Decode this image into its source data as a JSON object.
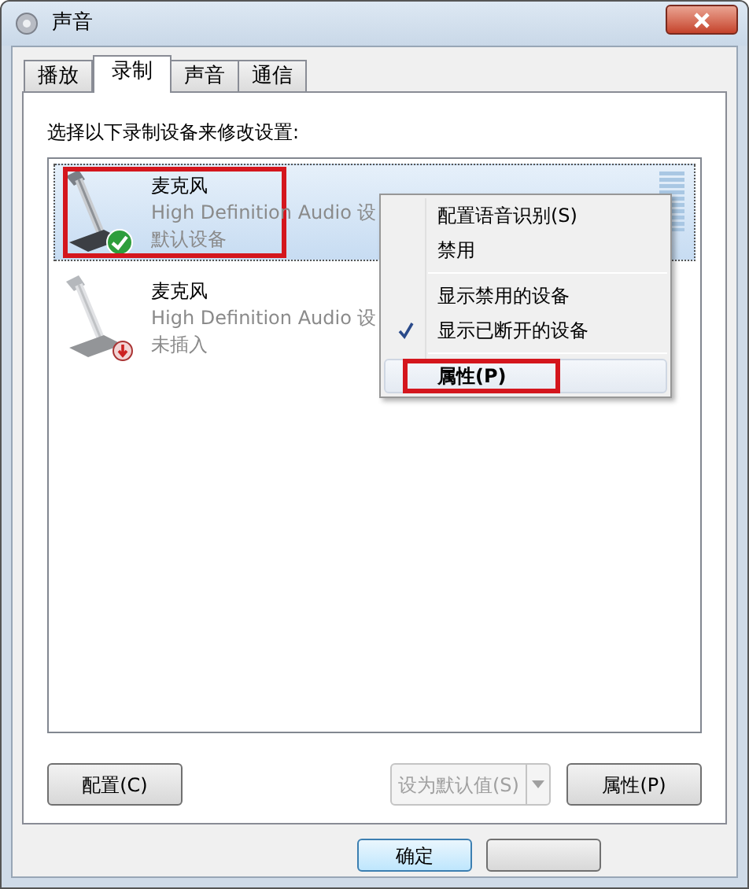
{
  "window": {
    "title": "声音"
  },
  "tabs": [
    {
      "label": "播放",
      "selected": false
    },
    {
      "label": "录制",
      "selected": true
    },
    {
      "label": "声音",
      "selected": false
    },
    {
      "label": "通信",
      "selected": false
    }
  ],
  "instruction": "选择以下录制设备来修改设置:",
  "devices": [
    {
      "name": "麦克风",
      "description": "High Definition Audio 设",
      "status": "默认设备",
      "kind": "default",
      "selected": true,
      "disabled": false,
      "highlighted": true
    },
    {
      "name": "麦克风",
      "description": "High Definition Audio 设",
      "status": "未插入",
      "kind": "unplugged",
      "selected": false,
      "disabled": true,
      "highlighted": false
    }
  ],
  "context_menu": {
    "items": [
      {
        "kind": "item",
        "label": "配置语音识别(S)",
        "checked": false,
        "hovered": false,
        "highlighted": false
      },
      {
        "kind": "item",
        "label": "禁用",
        "checked": false,
        "hovered": false,
        "highlighted": false
      },
      {
        "kind": "separator"
      },
      {
        "kind": "item",
        "label": "显示禁用的设备",
        "checked": false,
        "hovered": false,
        "highlighted": false
      },
      {
        "kind": "item",
        "label": "显示已断开的设备",
        "checked": true,
        "hovered": false,
        "highlighted": false
      },
      {
        "kind": "separator"
      },
      {
        "kind": "item",
        "label": "属性(P)",
        "checked": false,
        "hovered": true,
        "highlighted": true
      }
    ]
  },
  "panel_buttons": [
    {
      "kind": "button",
      "label": "配置(C)",
      "disabled": false
    },
    {
      "kind": "split",
      "label": "设为默认值(S)",
      "disabled": true
    },
    {
      "kind": "button",
      "label": "属性(P)",
      "disabled": false
    }
  ],
  "dialog_buttons": [
    {
      "label": "确定",
      "default": true
    },
    {
      "default": false
    }
  ]
}
